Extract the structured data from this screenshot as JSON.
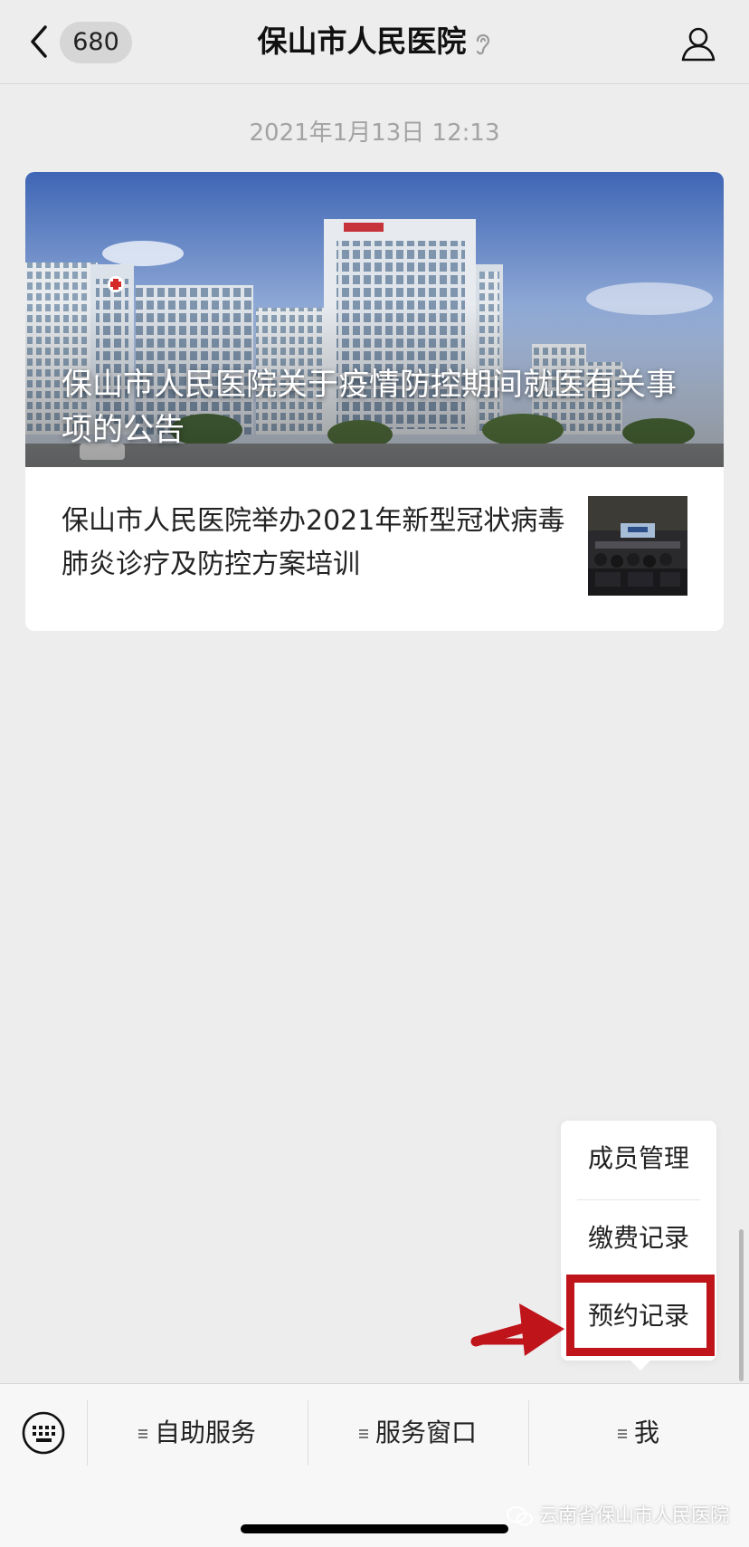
{
  "header": {
    "back_label": "<",
    "unread_count": "680",
    "title": "保山市人民医院"
  },
  "feed": {
    "timestamp": "2021年1月13日 12:13",
    "card": {
      "main_article_title": "保山市人民医院关于疫情防控期间就医有关事项的公告",
      "sub_article_title": "保山市人民医院举办2021年新型冠状病毒肺炎诊疗及防控方案培训"
    }
  },
  "submenu": {
    "items": [
      {
        "label": "成员管理"
      },
      {
        "label": "缴费记录"
      },
      {
        "label": "预约记录"
      }
    ]
  },
  "bottom_menu": {
    "items": [
      {
        "label": "自助服务"
      },
      {
        "label": "服务窗口"
      },
      {
        "label": "我"
      }
    ]
  },
  "watermark": "云南省保山市人民医院",
  "colors": {
    "background": "#ededed",
    "highlight": "#c0141b",
    "card": "#ffffff"
  }
}
